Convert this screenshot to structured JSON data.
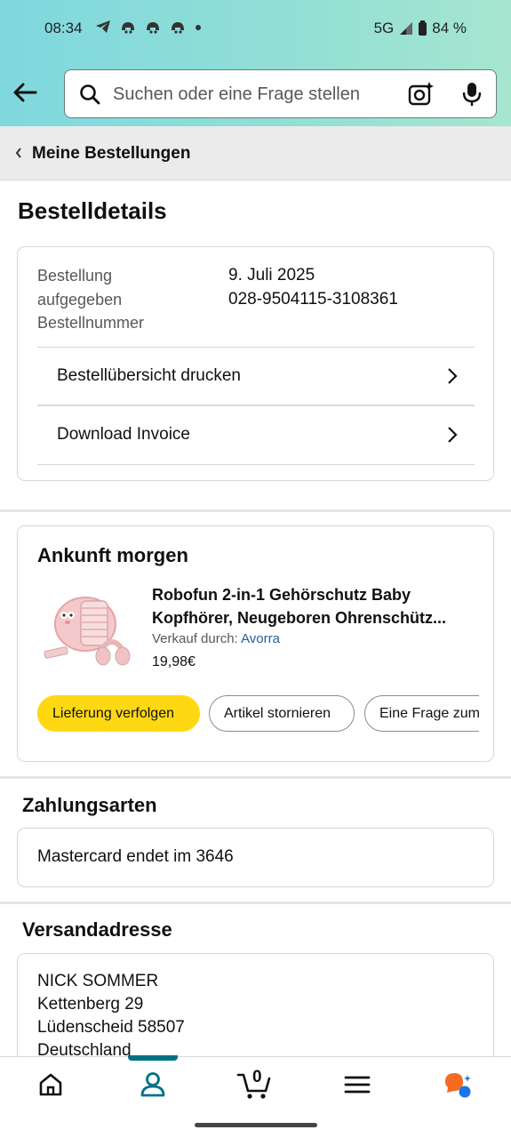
{
  "status_bar": {
    "time": "08:34",
    "network": "5G",
    "battery": "84 %"
  },
  "search": {
    "placeholder": "Suchen oder eine Frage stellen"
  },
  "breadcrumb": {
    "label": "Meine Bestellungen"
  },
  "page": {
    "title": "Bestelldetails"
  },
  "order_info": {
    "labels": [
      "Bestellung",
      "aufgegeben",
      "Bestellnummer"
    ],
    "date": "9. Juli 2025",
    "number": "028-9504115-3108361",
    "actions": [
      "Bestellübersicht drucken",
      "Download Invoice"
    ]
  },
  "shipment": {
    "status_title": "Ankunft morgen",
    "product_title_line1": "Robofun 2-in-1 Gehörschutz Baby",
    "product_title_line2": "Kopfhörer, Neugeboren Ohrenschütz...",
    "seller_prefix": "Verkauf durch:",
    "seller_name": "Avorra",
    "price": "19,98€",
    "buttons": [
      "Lieferung verfolgen",
      "Artikel stornieren",
      "Eine Frage zum"
    ]
  },
  "payment": {
    "heading": "Zahlungsarten",
    "method": "Mastercard  endet im 3646"
  },
  "shipping": {
    "heading": "Versandadresse",
    "lines": [
      "NICK SOMMER",
      "Kettenberg 29",
      "Lüdenscheid 58507",
      "Deutschland"
    ]
  },
  "bottom_nav": {
    "cart_count": "0",
    "icons": [
      "home-icon",
      "account-icon",
      "cart-icon",
      "menu-icon",
      "rufus-icon"
    ]
  },
  "colors": {
    "accent": "#007185",
    "button_yellow": "#ffd814",
    "link": "#2162a1"
  }
}
